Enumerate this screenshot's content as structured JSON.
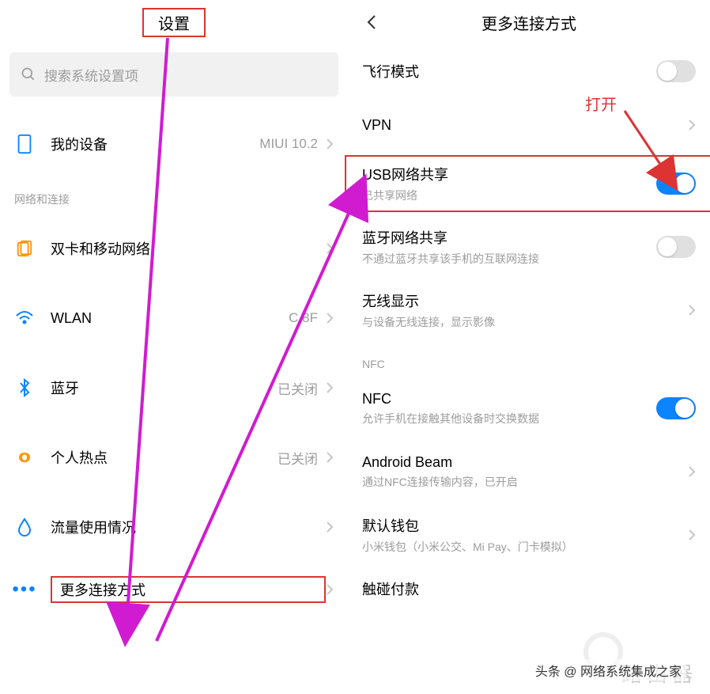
{
  "annotations": {
    "open_label": "打开",
    "credit": "头条 @ 网络系统集成之家",
    "watermark": "路由器"
  },
  "left": {
    "title": "设置",
    "search_placeholder": "搜索系统设置项",
    "my_device": {
      "label": "我的设备",
      "value": "MIUI 10.2"
    },
    "section_network": "网络和连接",
    "items": {
      "sim": {
        "label": "双卡和移动网络"
      },
      "wlan": {
        "label": "WLAN",
        "value": "C 8F"
      },
      "bt": {
        "label": "蓝牙",
        "value": "已关闭"
      },
      "hotspot": {
        "label": "个人热点",
        "value": "已关闭"
      },
      "data": {
        "label": "流量使用情况"
      },
      "more": {
        "label": "更多连接方式"
      }
    }
  },
  "right": {
    "title": "更多连接方式",
    "airplane": {
      "label": "飞行模式"
    },
    "vpn": {
      "label": "VPN"
    },
    "usb": {
      "label": "USB网络共享",
      "sub": "已共享网络"
    },
    "bt_tether": {
      "label": "蓝牙网络共享",
      "sub": "不通过蓝牙共享该手机的互联网连接"
    },
    "wdisplay": {
      "label": "无线显示",
      "sub": "与设备无线连接，显示影像"
    },
    "section_nfc": "NFC",
    "nfc": {
      "label": "NFC",
      "sub": "允许手机在接触其他设备时交换数据"
    },
    "beam": {
      "label": "Android Beam",
      "sub": "通过NFC连接传输内容，已开启"
    },
    "wallet": {
      "label": "默认钱包",
      "sub": "小米钱包（小米公交、Mi Pay、门卡模拟）"
    },
    "touchpay": {
      "label": "触碰付款"
    }
  }
}
